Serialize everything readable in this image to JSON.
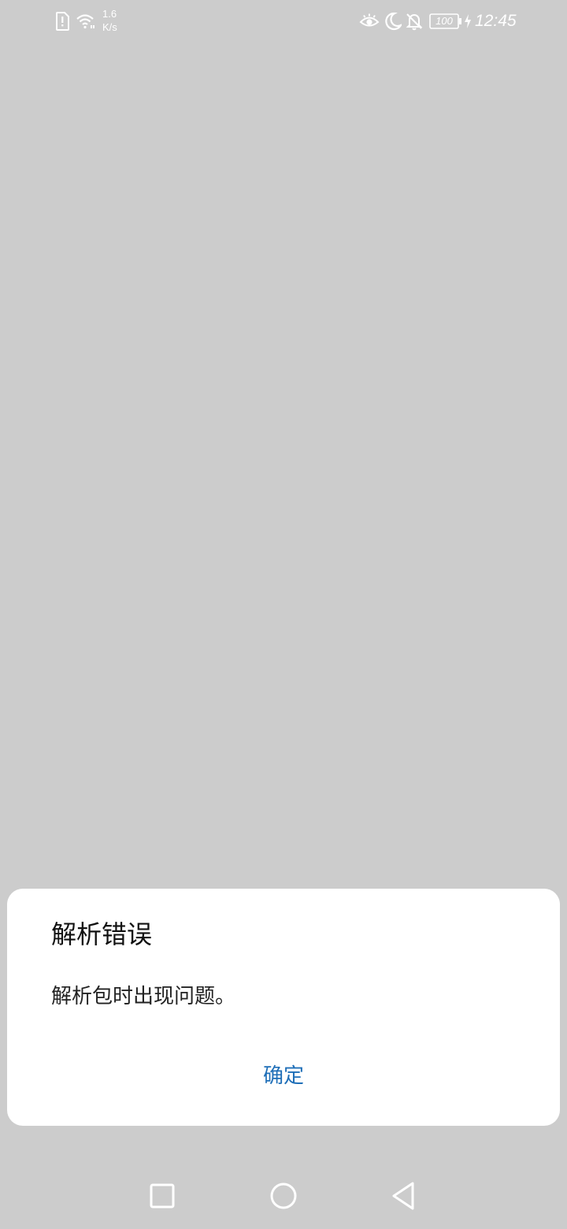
{
  "status_bar": {
    "net_speed_value": "1.6",
    "net_speed_unit": "K/s",
    "battery_level": "100",
    "time": "12:45",
    "icons": [
      "sim-alert-icon",
      "wifi-icon",
      "eye-icon",
      "moon-icon",
      "bell-off-icon",
      "battery-icon",
      "charging-icon"
    ]
  },
  "dialog": {
    "title": "解析错误",
    "message": "解析包时出现问题。",
    "confirm_label": "确定"
  },
  "nav_bar": {
    "icons": [
      "recents-icon",
      "home-icon",
      "back-icon"
    ]
  },
  "colors": {
    "background": "#cccccc",
    "dialog_bg": "#ffffff",
    "accent": "#1f6fb8"
  }
}
